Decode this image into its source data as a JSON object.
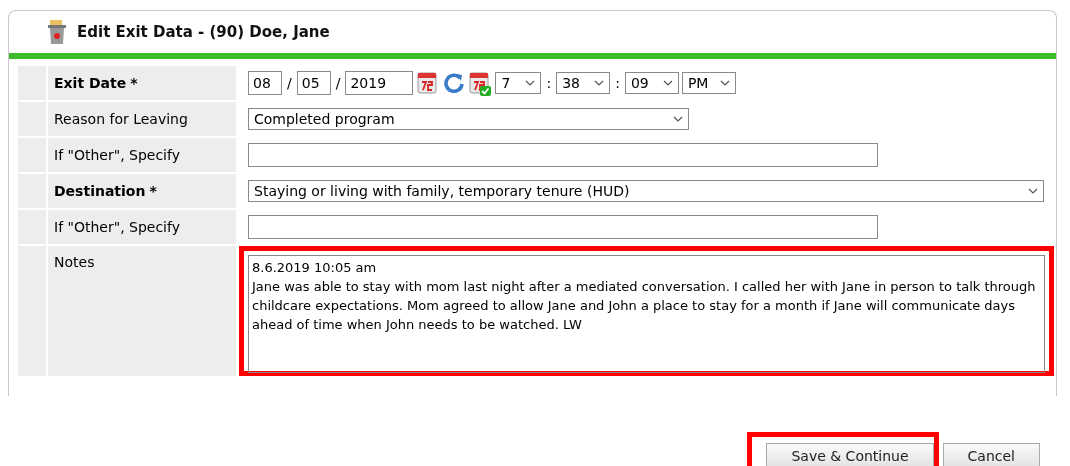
{
  "title": "Edit Exit Data - (90) Doe, Jane",
  "rows": [
    {
      "kind": "datetime",
      "label": "Exit Date",
      "required": true,
      "mark": "*",
      "month": "08",
      "day": "05",
      "year": "2019",
      "hour": "7",
      "minute": "38",
      "second": "09",
      "ampm": "PM",
      "separators": [
        "/",
        "/",
        ":",
        ":"
      ]
    },
    {
      "kind": "select",
      "label": "Reason for Leaving",
      "required": false,
      "value": "Completed program",
      "wide": false
    },
    {
      "kind": "text",
      "label": "If \"Other\", Specify",
      "required": false
    },
    {
      "kind": "select",
      "label": "Destination",
      "required": true,
      "mark": "*",
      "value": "Staying or living with family, temporary tenure (HUD)",
      "wide": true
    },
    {
      "kind": "text",
      "label": "If \"Other\", Specify",
      "required": false
    },
    {
      "kind": "textarea",
      "label": "Notes",
      "required": false,
      "highlighted": true,
      "value": "8.6.2019 10:05 am\nJane was able to stay with mom last night after a mediated conversation. I called her with Jane in person to talk through childcare expectations. Mom agreed to allow Jane and John a place to stay for a month if Jane will communicate days ahead of time when John needs to be watched. LW"
    }
  ],
  "buttons": [
    {
      "label": "Save & Continue",
      "highlighted": true
    },
    {
      "label": "Cancel",
      "highlighted": false
    }
  ]
}
